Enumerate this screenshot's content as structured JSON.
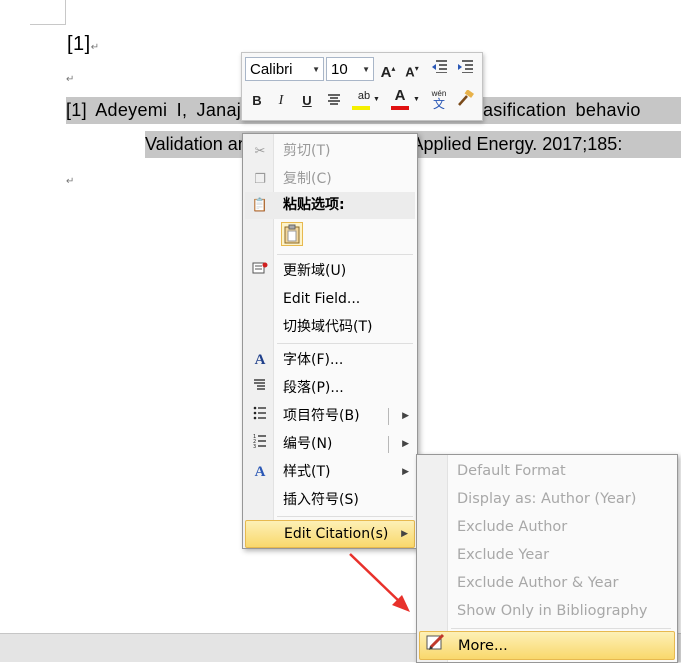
{
  "document": {
    "ref_marker": "[1]",
    "paragraph_mark": "↵",
    "line1": "[1] Adeyemi I, Janajreh I, Arink T, Ghenai C. Gasification behavio",
    "line2": "Validation and comparison study. Applied Energy. 2017;185:"
  },
  "minibar": {
    "font": "Calibri",
    "size": "10",
    "grow": "A",
    "shrink": "A",
    "bold": "B",
    "italic": "I",
    "underline": "U",
    "highlight": "ab",
    "font_color": "A",
    "phonetic_top": "wén",
    "phonetic_bottom": "文"
  },
  "context_menu": {
    "cut": "剪切(T)",
    "copy": "复制(C)",
    "paste_options": "粘贴选项:",
    "update_field": "更新域(U)",
    "edit_field": "Edit Field...",
    "toggle_field_codes": "切换域代码(T)",
    "font": "字体(F)...",
    "paragraph": "段落(P)...",
    "bullets": "项目符号(B)",
    "numbering": "编号(N)",
    "styles": "样式(T)",
    "insert_symbol": "插入符号(S)",
    "edit_citations": "Edit Citation(s)"
  },
  "submenu": {
    "default_format": "Default Format",
    "display_as": "Display as: Author (Year)",
    "exclude_author": "Exclude Author",
    "exclude_year": "Exclude Year",
    "exclude_author_year": "Exclude Author & Year",
    "show_only_bib": "Show Only in Bibliography",
    "more": "More..."
  },
  "colors": {
    "selection": "#c6c6c6",
    "hover_top": "#fdf0b6",
    "hover_bottom": "#f9d86c",
    "arrow": "#e8312b",
    "highlight_bar": "#f5f000",
    "font_color_bar": "#e01010"
  },
  "icons": [
    "scissors-icon",
    "copy-icon",
    "clipboard-icon",
    "update-field-icon",
    "font-icon",
    "paragraph-icon",
    "bullets-icon",
    "numbering-icon",
    "styles-icon",
    "edit-pencil-icon",
    "red-arrow-icon"
  ]
}
